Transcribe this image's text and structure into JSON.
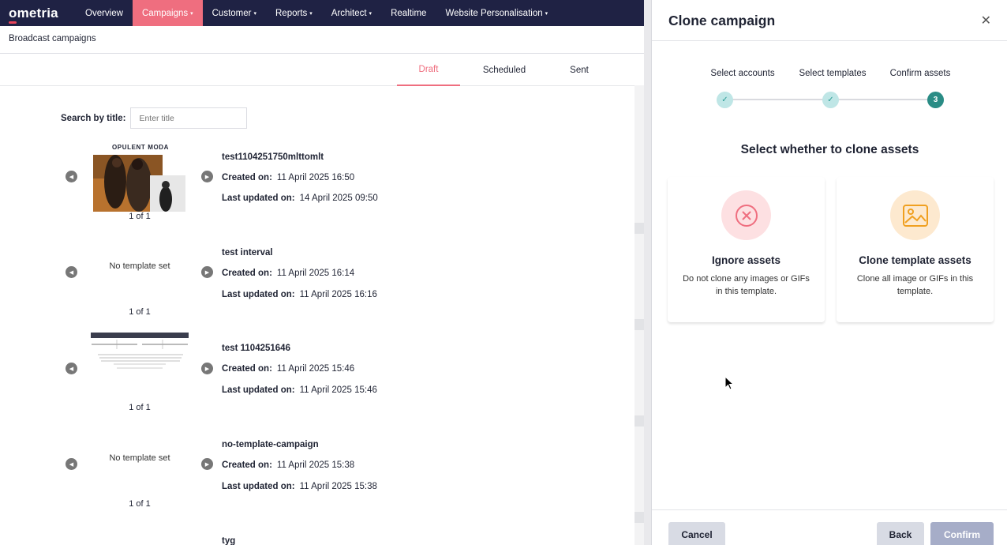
{
  "app": {
    "logo": "ometria"
  },
  "nav": {
    "items": [
      {
        "label": "Overview",
        "caret": ""
      },
      {
        "label": "Campaigns",
        "caret": "▾"
      },
      {
        "label": "Customer",
        "caret": "▾"
      },
      {
        "label": "Reports",
        "caret": "▾"
      },
      {
        "label": "Architect",
        "caret": "▾"
      },
      {
        "label": "Realtime",
        "caret": ""
      },
      {
        "label": "Website Personalisation",
        "caret": "▾"
      }
    ]
  },
  "page": {
    "breadcrumb": "Broadcast campaigns"
  },
  "tabs": [
    "Draft",
    "Scheduled",
    "Sent"
  ],
  "search": {
    "label": "Search by title:",
    "placeholder": "Enter title"
  },
  "labels": {
    "created": "Created on:",
    "updated": "Last updated on:",
    "no_template": "No template set"
  },
  "campaigns": [
    {
      "title": "test1104251750mlttomlt",
      "created": "11 April 2025 16:50",
      "updated": "14 April 2025 09:50",
      "pager": "1 of 1",
      "thumb_caption": "OPULENT MODA"
    },
    {
      "title": "test interval",
      "created": "11 April 2025 16:14",
      "updated": "11 April 2025 16:16",
      "pager": "1 of 1"
    },
    {
      "title": "test 1104251646",
      "created": "11 April 2025 15:46",
      "updated": "11 April 2025 15:46",
      "pager": "1 of 1"
    },
    {
      "title": "no-template-campaign",
      "created": "11 April 2025 15:38",
      "updated": "11 April 2025 15:38",
      "pager": "1 of 1"
    },
    {
      "title": "tyg"
    }
  ],
  "panel": {
    "title": "Clone campaign",
    "steps": [
      {
        "label": "Select accounts",
        "state": "done",
        "marker": "✓"
      },
      {
        "label": "Select templates",
        "state": "done",
        "marker": "✓"
      },
      {
        "label": "Confirm assets",
        "state": "current",
        "marker": "3"
      }
    ],
    "question": "Select whether to clone assets",
    "options": [
      {
        "title": "Ignore assets",
        "desc": "Do not clone any images or GIFs in this template.",
        "icon": "x-circle-icon",
        "icon_bg": "#fde0e2",
        "icon_color": "#ef6e7f"
      },
      {
        "title": "Clone template assets",
        "desc": "Clone all image or GIFs in this template.",
        "icon": "image-icon",
        "icon_bg": "#fde9cf",
        "icon_color": "#f0a020"
      }
    ],
    "buttons": {
      "cancel": "Cancel",
      "back": "Back",
      "confirm": "Confirm"
    }
  }
}
